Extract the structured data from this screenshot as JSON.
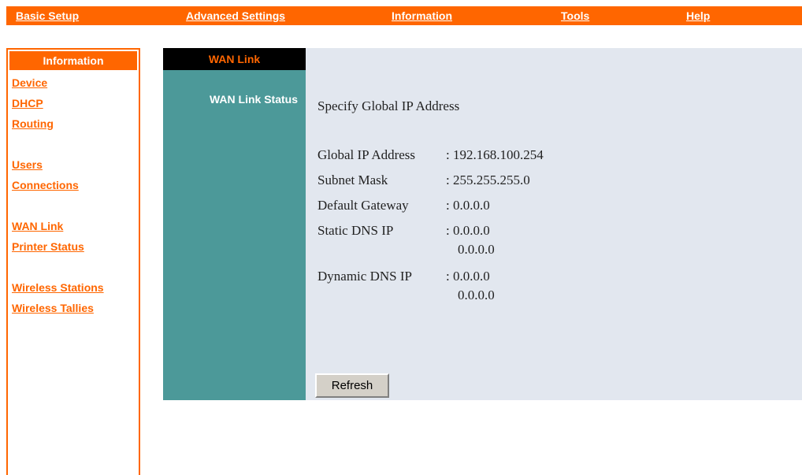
{
  "top_nav": [
    {
      "label": "Basic Setup"
    },
    {
      "label": "Advanced Settings"
    },
    {
      "label": "Information"
    },
    {
      "label": "Tools"
    },
    {
      "label": "Help"
    }
  ],
  "sidebar": {
    "header": "Information",
    "items": [
      {
        "label": "Device"
      },
      {
        "label": "DHCP"
      },
      {
        "label": "Routing"
      },
      {
        "label": "Users"
      },
      {
        "label": "Connections"
      },
      {
        "label": "WAN Link"
      },
      {
        "label": "Printer Status"
      },
      {
        "label": "Wireless Stations"
      },
      {
        "label": "Wireless Tallies"
      }
    ]
  },
  "panel": {
    "tab_label": "WAN Link",
    "section_label": "WAN Link Status"
  },
  "main": {
    "heading": "Specify Global IP Address",
    "rows": [
      {
        "label": "Global IP Address",
        "value": ": 192.168.100.254"
      },
      {
        "label": "Subnet Mask",
        "value": ": 255.255.255.0"
      },
      {
        "label": "Default Gateway",
        "value": ": 0.0.0.0"
      },
      {
        "label": "Static DNS IP",
        "value": ": 0.0.0.0",
        "value2": "0.0.0.0"
      },
      {
        "label": "Dynamic DNS IP",
        "value": ": 0.0.0.0",
        "value2": "0.0.0.0"
      }
    ],
    "refresh_label": "Refresh"
  },
  "colors": {
    "accent": "#ff6600",
    "panel_teal": "#4c9999",
    "content_bg": "#e2e7ef"
  }
}
